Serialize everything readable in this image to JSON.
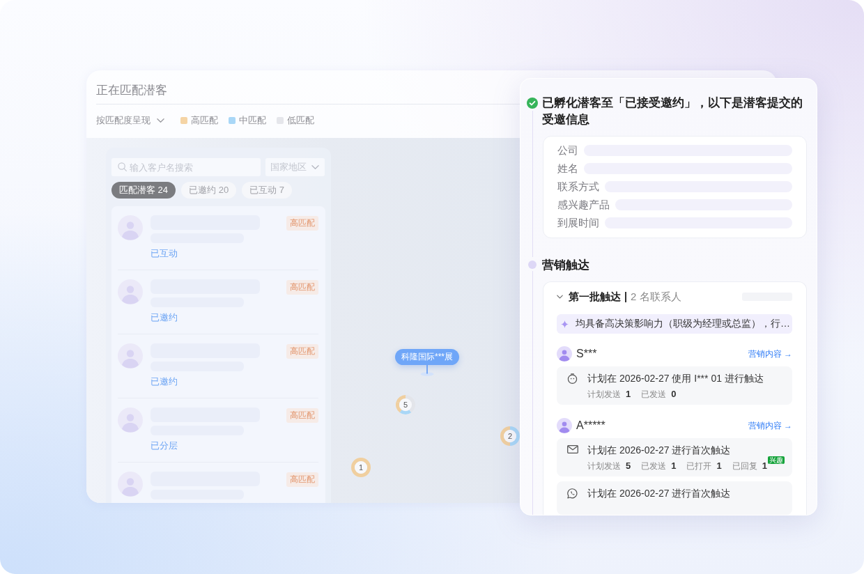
{
  "main_panel": {
    "title": "正在匹配潜客",
    "view_select": {
      "label": "按匹配度呈现"
    },
    "legend": [
      {
        "label": "高匹配",
        "color": "#f5d4a5"
      },
      {
        "label": "中匹配",
        "color": "#a9d7f7"
      },
      {
        "label": "低匹配",
        "color": "#e5e6eb"
      }
    ]
  },
  "customer_list": {
    "search": {
      "placeholder": "输入客户名搜索"
    },
    "region_select": {
      "placeholder": "国家地区"
    },
    "tabs": [
      {
        "label": "匹配潜客 24",
        "selected": true
      },
      {
        "label": "已邀约 20",
        "selected": false
      },
      {
        "label": "已互动 7",
        "selected": false
      }
    ],
    "items": [
      {
        "match": "高匹配",
        "status": "已互动"
      },
      {
        "match": "高匹配",
        "status": "已邀约"
      },
      {
        "match": "高匹配",
        "status": "已邀约"
      },
      {
        "match": "高匹配",
        "status": "已分层"
      },
      {
        "match": "高匹配"
      }
    ]
  },
  "map": {
    "event_pin": {
      "label": "科隆国际***展"
    },
    "clusters": [
      {
        "count": "5",
        "segments": [
          {
            "color": "#f0cf9f"
          },
          {
            "color": "#f0cf9f"
          },
          {
            "color": "#a9d7f7"
          },
          {
            "color": "#e3e5ea"
          },
          {
            "color": "#e3e5ea"
          }
        ]
      },
      {
        "count": "1",
        "segments": [
          {
            "color": "#f0cf9f"
          }
        ]
      },
      {
        "count": "2",
        "segments": [
          {
            "color": "#f0cf9f"
          },
          {
            "color": "#a9d7f7"
          }
        ]
      }
    ]
  },
  "detail_panel": {
    "timeline": [
      {
        "completed": true,
        "title": "已孵化潜客至「已接受邀约」，以下是潜客提交的受邀信息",
        "fields": [
          {
            "label": "公司"
          },
          {
            "label": "姓名"
          },
          {
            "label": "联系方式"
          },
          {
            "label": "感兴趣产品"
          },
          {
            "label": "到展时间"
          }
        ]
      },
      {
        "completed": false,
        "title": "营销触达",
        "batches": [
          {
            "expanded": true,
            "title": "第一批触达",
            "contacts_count": "2 名联系人",
            "insight": "均具备高决策影响力（职级为经理或总监），行…",
            "contacts": [
              {
                "name": "S***",
                "link": "营销内容 →",
                "plans": [
                  {
                    "kind": "timer",
                    "text": "计划在 2026-02-27 使用 I*** 01 进行触达",
                    "stats": [
                      {
                        "label": "计划发送",
                        "value": "1"
                      },
                      {
                        "label": "已发送",
                        "value": "0"
                      }
                    ]
                  }
                ]
              },
              {
                "name": "A*****",
                "link": "营销内容 →",
                "plans": [
                  {
                    "kind": "email",
                    "text": "计划在 2026-02-27 进行首次触达",
                    "stats": [
                      {
                        "label": "计划发送",
                        "value": "5"
                      },
                      {
                        "label": "已发送",
                        "value": "1"
                      },
                      {
                        "label": "已打开",
                        "value": "1"
                      },
                      {
                        "label": "已回复",
                        "value": "1",
                        "badge": "兴趣"
                      }
                    ]
                  },
                  {
                    "kind": "whatsapp",
                    "text": "计划在 2026-02-27 进行首次触达"
                  }
                ]
              }
            ]
          }
        ]
      }
    ]
  }
}
